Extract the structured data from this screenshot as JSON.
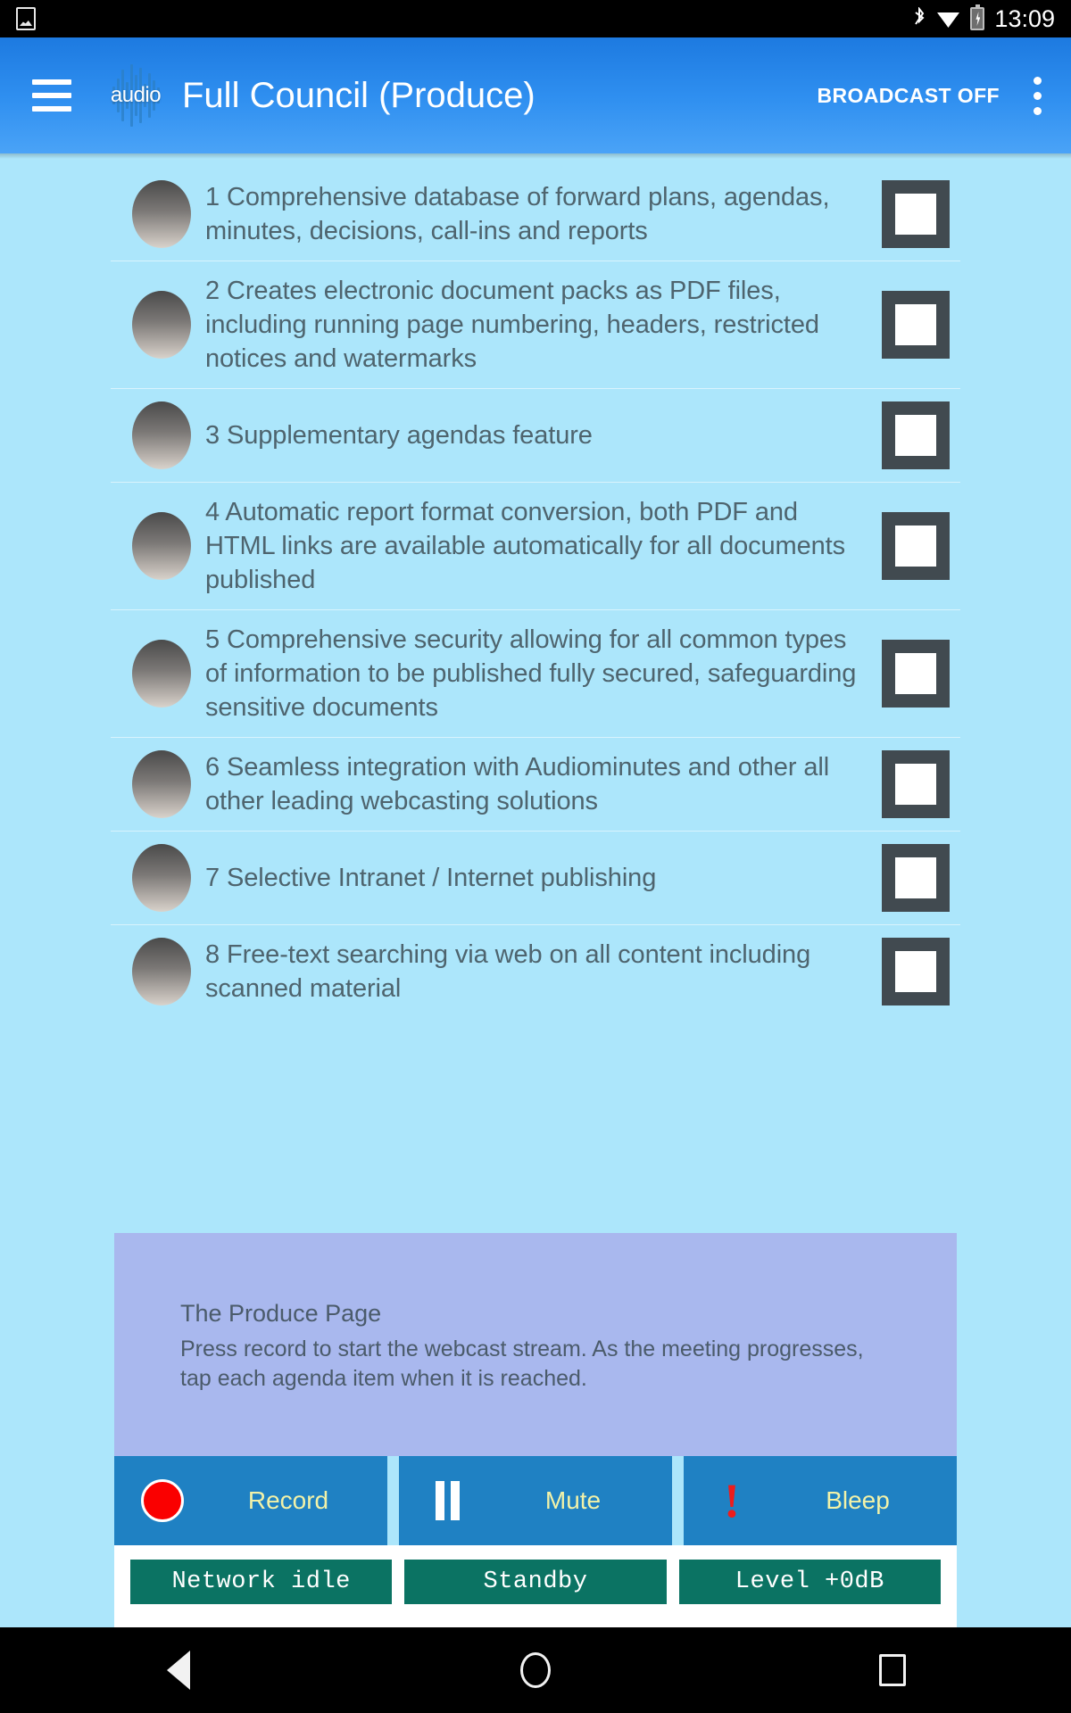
{
  "status_bar": {
    "left_icon": "image-icon",
    "icons": [
      "bluetooth-icon",
      "wifi-icon",
      "battery-charging-icon"
    ],
    "clock": "13:09"
  },
  "app_bar": {
    "menu_icon": "hamburger-menu-icon",
    "logo_text": "audio",
    "title": "Full Council (Produce)",
    "broadcast_label": "BROADCAST OFF",
    "overflow_icon": "more-vertical-icon"
  },
  "agenda": {
    "items": [
      {
        "text": "1 Comprehensive database of forward plans, agendas, minutes, decisions, call-ins and reports",
        "checked": false
      },
      {
        "text": "2 Creates electronic document packs as PDF files, including running page numbering, headers, restricted notices and watermarks",
        "checked": false
      },
      {
        "text": "3 Supplementary agendas feature",
        "checked": false
      },
      {
        "text": "4 Automatic report format conversion, both PDF and HTML links are available automatically for all documents published",
        "checked": false
      },
      {
        "text": "5 Comprehensive security allowing for all common types of information to be published fully secured, safeguarding sensitive documents",
        "checked": false
      },
      {
        "text": "6 Seamless integration with Audiominutes and other all other leading webcasting solutions",
        "checked": false
      },
      {
        "text": "7 Selective Intranet / Internet publishing",
        "checked": false
      },
      {
        "text": "8 Free-text searching via web on all content including scanned material",
        "checked": false
      }
    ]
  },
  "info_panel": {
    "title": "The Produce Page",
    "body": "Press record to start the webcast stream. As the meeting progresses, tap each agenda item when it is reached."
  },
  "actions": [
    {
      "label": "Record",
      "icon": "record-circle-icon"
    },
    {
      "label": "Mute",
      "icon": "pause-bars-icon"
    },
    {
      "label": "Bleep",
      "icon": "exclamation-icon"
    }
  ],
  "status_chips": [
    {
      "label": "Network idle"
    },
    {
      "label": "Standby"
    },
    {
      "label": "Level +0dB"
    }
  ],
  "nav_bar": {
    "back": "back-triangle-icon",
    "home": "home-circle-icon",
    "recents": "recents-square-icon"
  },
  "colors": {
    "page_bg": "#ace6fb",
    "app_bar": "#2f8ff0",
    "accent_button": "#1f81c3",
    "button_text": "#f2f2a8",
    "status_chip": "#0b7363",
    "info_panel": "#a9b8ee",
    "text": "#4e646e",
    "checkbox_border": "#414a50",
    "record_red": "#fa0000"
  }
}
